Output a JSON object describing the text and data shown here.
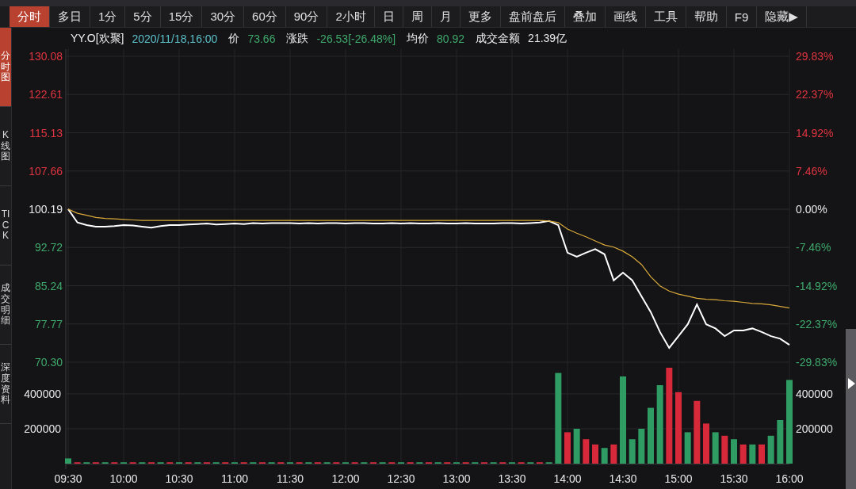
{
  "toolbar": {
    "tabs": [
      {
        "label": "分时",
        "selected": true
      },
      {
        "label": "多日",
        "selected": false
      },
      {
        "label": "1分",
        "selected": false
      },
      {
        "label": "5分",
        "selected": false
      },
      {
        "label": "15分",
        "selected": false
      },
      {
        "label": "30分",
        "selected": false
      },
      {
        "label": "60分",
        "selected": false
      },
      {
        "label": "90分",
        "selected": false
      },
      {
        "label": "2小时",
        "selected": false
      },
      {
        "label": "日",
        "selected": false
      },
      {
        "label": "周",
        "selected": false
      },
      {
        "label": "月",
        "selected": false
      },
      {
        "label": "更多",
        "selected": false
      },
      {
        "label": "盘前盘后",
        "selected": false
      },
      {
        "label": "叠加",
        "selected": false
      },
      {
        "label": "画线",
        "selected": false
      },
      {
        "label": "工具",
        "selected": false
      },
      {
        "label": "帮助",
        "selected": false
      },
      {
        "label": "F9",
        "selected": false
      },
      {
        "label": "隐藏▶",
        "selected": false
      }
    ]
  },
  "sidebar": {
    "items": [
      {
        "label": "分时图",
        "selected": true
      },
      {
        "label": "K线图",
        "selected": false
      },
      {
        "label": "TICK",
        "selected": false
      },
      {
        "label": "成交明细",
        "selected": false
      },
      {
        "label": "深度资料",
        "selected": false
      }
    ]
  },
  "info": {
    "symbol": "YY.O[欢聚]",
    "datetime": "2020/11/18,16:00",
    "fields": [
      {
        "label": "价",
        "value": "73.66",
        "color": "#3fa86b"
      },
      {
        "label": "涨跌",
        "value": "-26.53[-26.48%]",
        "color": "#3fa86b"
      },
      {
        "label": "均价",
        "value": "80.92",
        "color": "#3fa86b"
      },
      {
        "label": "成交金额",
        "value": "21.39亿",
        "color": "#e8e8e8"
      }
    ]
  },
  "price_chart": {
    "right_axis": [
      {
        "label": "29.83%",
        "color": "#e0343f"
      },
      {
        "label": "22.37%",
        "color": "#e0343f"
      },
      {
        "label": "14.92%",
        "color": "#e0343f"
      },
      {
        "label": "7.46%",
        "color": "#e0343f"
      },
      {
        "label": "0.00%",
        "color": "#e8e8e8"
      },
      {
        "label": "-7.46%",
        "color": "#3fa86b"
      },
      {
        "label": "-14.92%",
        "color": "#3fa86b"
      },
      {
        "label": "-22.37%",
        "color": "#3fa86b"
      },
      {
        "label": "-29.83%",
        "color": "#3fa86b"
      }
    ],
    "chart_data": {
      "type": "line",
      "grid": true,
      "ylim": [
        69.53,
        131.47
      ],
      "yticks": [
        {
          "value": 130.08,
          "label": "130.08"
        },
        {
          "value": 122.61,
          "label": "122.61"
        },
        {
          "value": 115.13,
          "label": "115.13"
        },
        {
          "value": 107.66,
          "label": "107.66"
        },
        {
          "value": 100.19,
          "label": "100.19"
        },
        {
          "value": 92.72,
          "label": "92.72"
        },
        {
          "value": 85.24,
          "label": "85.24"
        },
        {
          "value": 77.77,
          "label": "77.77"
        },
        {
          "value": 70.3,
          "label": "70.30"
        }
      ],
      "series": [
        {
          "color": "#ffffff",
          "values": [
            100.2,
            97.6,
            97.1,
            96.8,
            96.8,
            96.9,
            97.1,
            97.0,
            96.8,
            96.6,
            96.9,
            97.1,
            97.1,
            97.2,
            97.3,
            97.4,
            97.2,
            97.3,
            97.4,
            97.3,
            97.5,
            97.4,
            97.5,
            97.5,
            97.5,
            97.4,
            97.5,
            97.4,
            97.5,
            97.5,
            97.4,
            97.5,
            97.5,
            97.4,
            97.4,
            97.5,
            97.4,
            97.5,
            97.4,
            97.4,
            97.5,
            97.4,
            97.4,
            97.5,
            97.4,
            97.4,
            97.4,
            97.5,
            97.5,
            97.4,
            97.5,
            97.6,
            97.9,
            97.1,
            91.7,
            90.9,
            91.7,
            92.4,
            91.4,
            86.3,
            87.8,
            86.3,
            83.2,
            80.1,
            76.2,
            73.1,
            75.4,
            77.7,
            81.6,
            77.7,
            76.9,
            75.4,
            76.5,
            76.5,
            76.9,
            76.2,
            75.4,
            74.9,
            73.7
          ]
        },
        {
          "color": "#d9a93a",
          "values": [
            100.2,
            99.4,
            99.0,
            98.6,
            98.4,
            98.3,
            98.2,
            98.1,
            98.0,
            98.0,
            98.0,
            98.0,
            98.0,
            98.0,
            98.0,
            98.0,
            98.0,
            98.0,
            98.0,
            98.0,
            98.0,
            98.0,
            98.0,
            98.0,
            98.0,
            98.0,
            98.0,
            98.0,
            98.0,
            98.0,
            98.0,
            98.0,
            98.0,
            98.0,
            98.0,
            98.0,
            98.0,
            98.0,
            98.0,
            98.0,
            98.0,
            98.0,
            98.0,
            98.0,
            98.0,
            98.0,
            98.0,
            98.0,
            98.0,
            98.0,
            98.0,
            98.0,
            97.9,
            97.6,
            96.3,
            95.5,
            94.8,
            94.0,
            93.2,
            92.8,
            92.0,
            90.9,
            89.4,
            87.0,
            85.2,
            84.2,
            83.6,
            83.2,
            82.8,
            82.6,
            82.5,
            82.3,
            82.2,
            82.0,
            81.8,
            81.7,
            81.5,
            81.2,
            80.9
          ]
        }
      ]
    }
  },
  "volume_chart": {
    "right_axis": [
      "400000",
      "200000"
    ],
    "chart_data": {
      "type": "bar",
      "stacked": true,
      "grid": true,
      "ylim": [
        0,
        559000
      ],
      "yticks": [
        {
          "value": 400000,
          "label": "400000"
        },
        {
          "value": 200000,
          "label": "200000"
        }
      ],
      "categories": [
        "09:30",
        null,
        null,
        null,
        null,
        null,
        "10:00",
        null,
        null,
        null,
        null,
        null,
        "10:30",
        null,
        null,
        null,
        null,
        null,
        "11:00",
        null,
        null,
        null,
        null,
        null,
        "11:30",
        null,
        null,
        null,
        null,
        null,
        "12:00",
        null,
        null,
        null,
        null,
        null,
        "12:30",
        null,
        null,
        null,
        null,
        null,
        "13:00",
        null,
        null,
        null,
        null,
        null,
        "13:30",
        null,
        null,
        null,
        null,
        null,
        "14:00",
        null,
        null,
        null,
        null,
        null,
        "14:30",
        null,
        null,
        null,
        null,
        null,
        "15:00",
        null,
        null,
        null,
        null,
        null,
        "15:30",
        null,
        null,
        null,
        null,
        null,
        "16:00"
      ],
      "series": [
        {
          "color": "#2e9c63",
          "values": [
            30000,
            null,
            8000,
            null,
            8000,
            null,
            8000,
            null,
            8000,
            null,
            8000,
            null,
            8000,
            null,
            8000,
            null,
            8000,
            null,
            8000,
            null,
            8000,
            null,
            8000,
            null,
            8000,
            null,
            8000,
            null,
            8000,
            null,
            8000,
            null,
            8000,
            null,
            8000,
            null,
            8000,
            null,
            8000,
            null,
            8000,
            null,
            8000,
            null,
            8000,
            null,
            8000,
            null,
            8000,
            null,
            8000,
            null,
            8000,
            520000,
            null,
            200000,
            null,
            null,
            90000,
            null,
            500000,
            140000,
            200000,
            320000,
            450000,
            null,
            null,
            180000,
            null,
            null,
            180000,
            null,
            140000,
            null,
            110000,
            null,
            160000,
            250000,
            480000
          ]
        },
        {
          "color": "#d8293a",
          "values": [
            null,
            8000,
            null,
            8000,
            null,
            8000,
            null,
            8000,
            null,
            8000,
            null,
            8000,
            null,
            8000,
            null,
            8000,
            null,
            8000,
            null,
            8000,
            null,
            8000,
            null,
            8000,
            null,
            8000,
            null,
            8000,
            null,
            8000,
            null,
            8000,
            null,
            8000,
            null,
            8000,
            null,
            8000,
            null,
            8000,
            null,
            8000,
            null,
            8000,
            null,
            8000,
            null,
            8000,
            null,
            8000,
            null,
            8000,
            null,
            null,
            180000,
            null,
            140000,
            110000,
            null,
            110000,
            null,
            null,
            null,
            null,
            null,
            550000,
            410000,
            null,
            360000,
            230000,
            null,
            160000,
            null,
            110000,
            null,
            110000,
            null,
            null,
            null
          ]
        }
      ]
    }
  }
}
